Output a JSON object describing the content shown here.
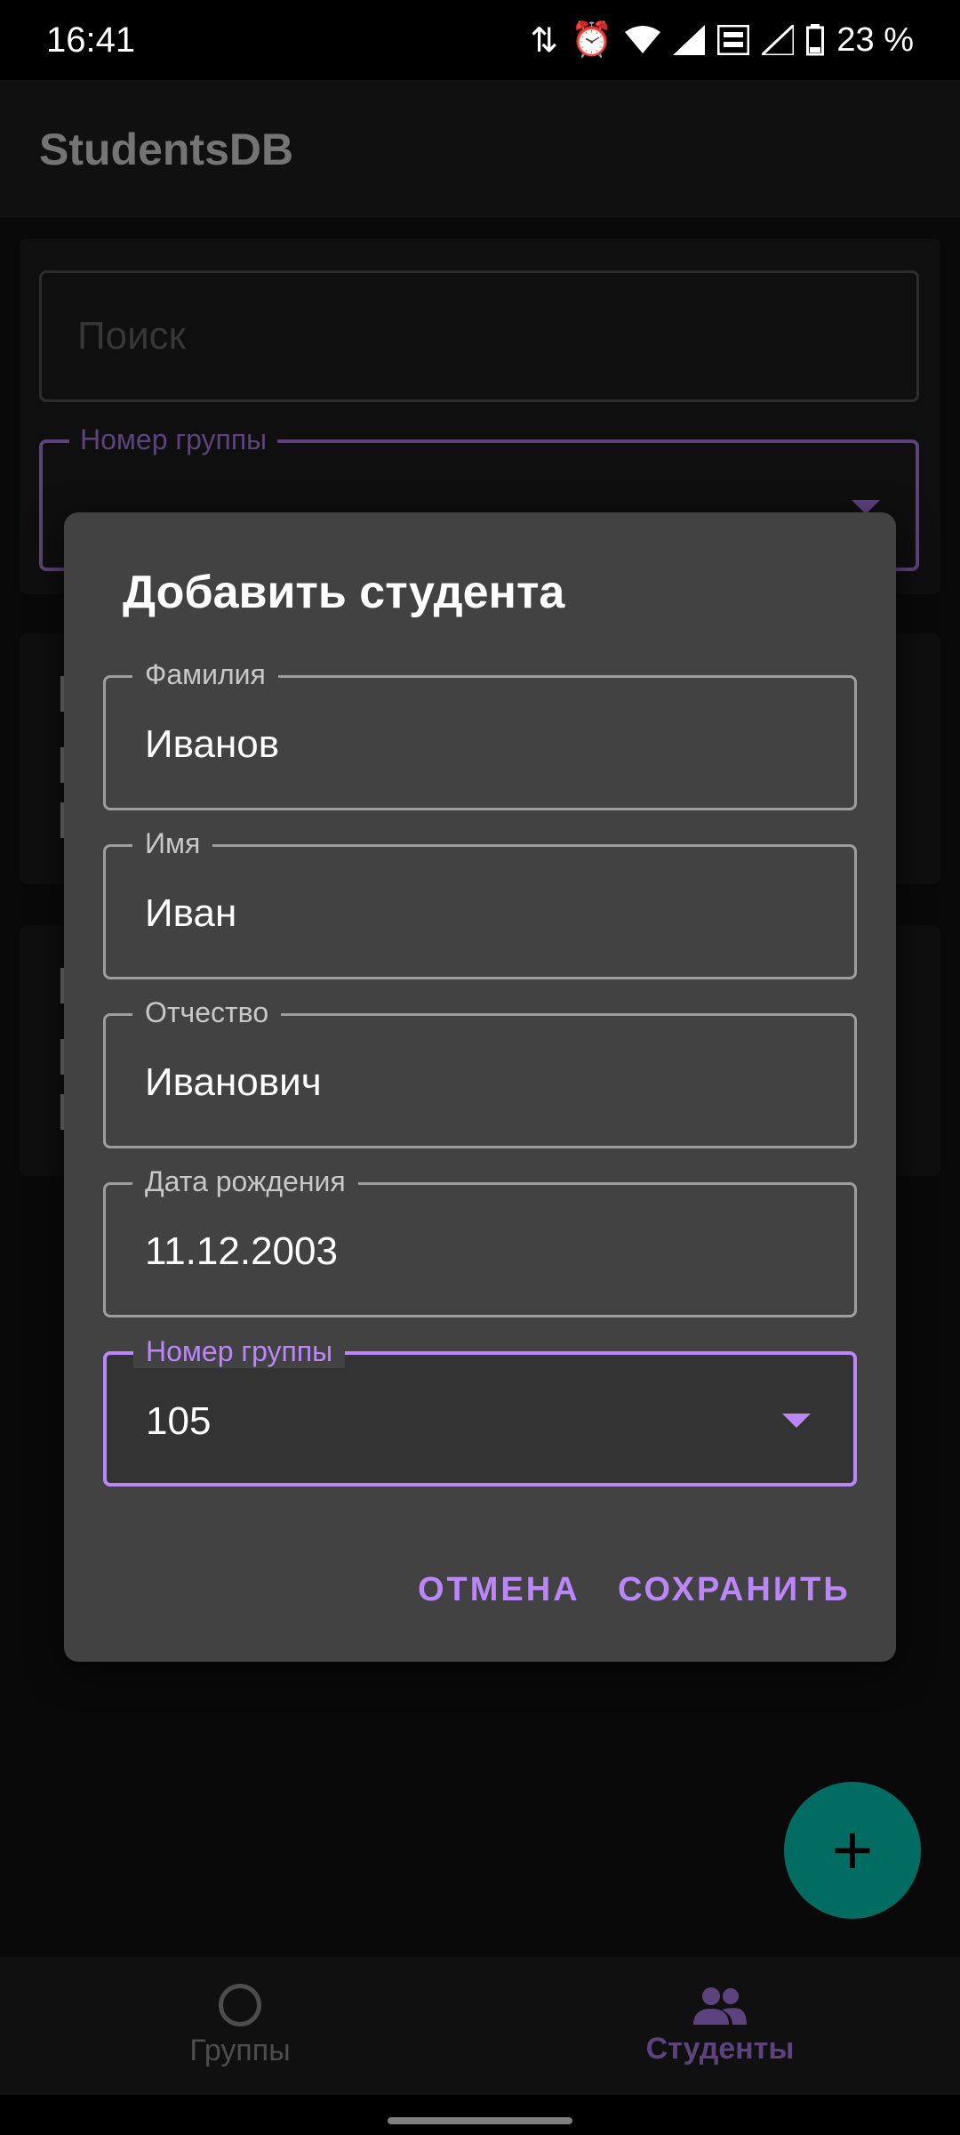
{
  "status_bar": {
    "time": "16:41",
    "battery": "23 %"
  },
  "app_bar": {
    "title": "StudentsDB"
  },
  "filters": {
    "search_placeholder": "Поиск",
    "group_label": "Номер группы"
  },
  "dialog": {
    "title": "Добавить студента",
    "fields": [
      {
        "label": "Фамилия",
        "value": "Иванов"
      },
      {
        "label": "Имя",
        "value": "Иван"
      },
      {
        "label": "Отчество",
        "value": "Иванович"
      },
      {
        "label": "Дата рождения",
        "value": "11.12.2003"
      }
    ],
    "group": {
      "label": "Номер группы",
      "value": "105"
    },
    "cancel_label": "ОТМЕНА",
    "save_label": "СОХРАНИТЬ"
  },
  "bottom_nav": {
    "items": [
      {
        "label": "Группы",
        "icon": "circle-icon",
        "active": false
      },
      {
        "label": "Студенты",
        "icon": "people-icon",
        "active": true
      }
    ]
  },
  "colors": {
    "accent": "#bb86fc",
    "fab": "#03dac5",
    "dialog_bg": "#424242"
  }
}
